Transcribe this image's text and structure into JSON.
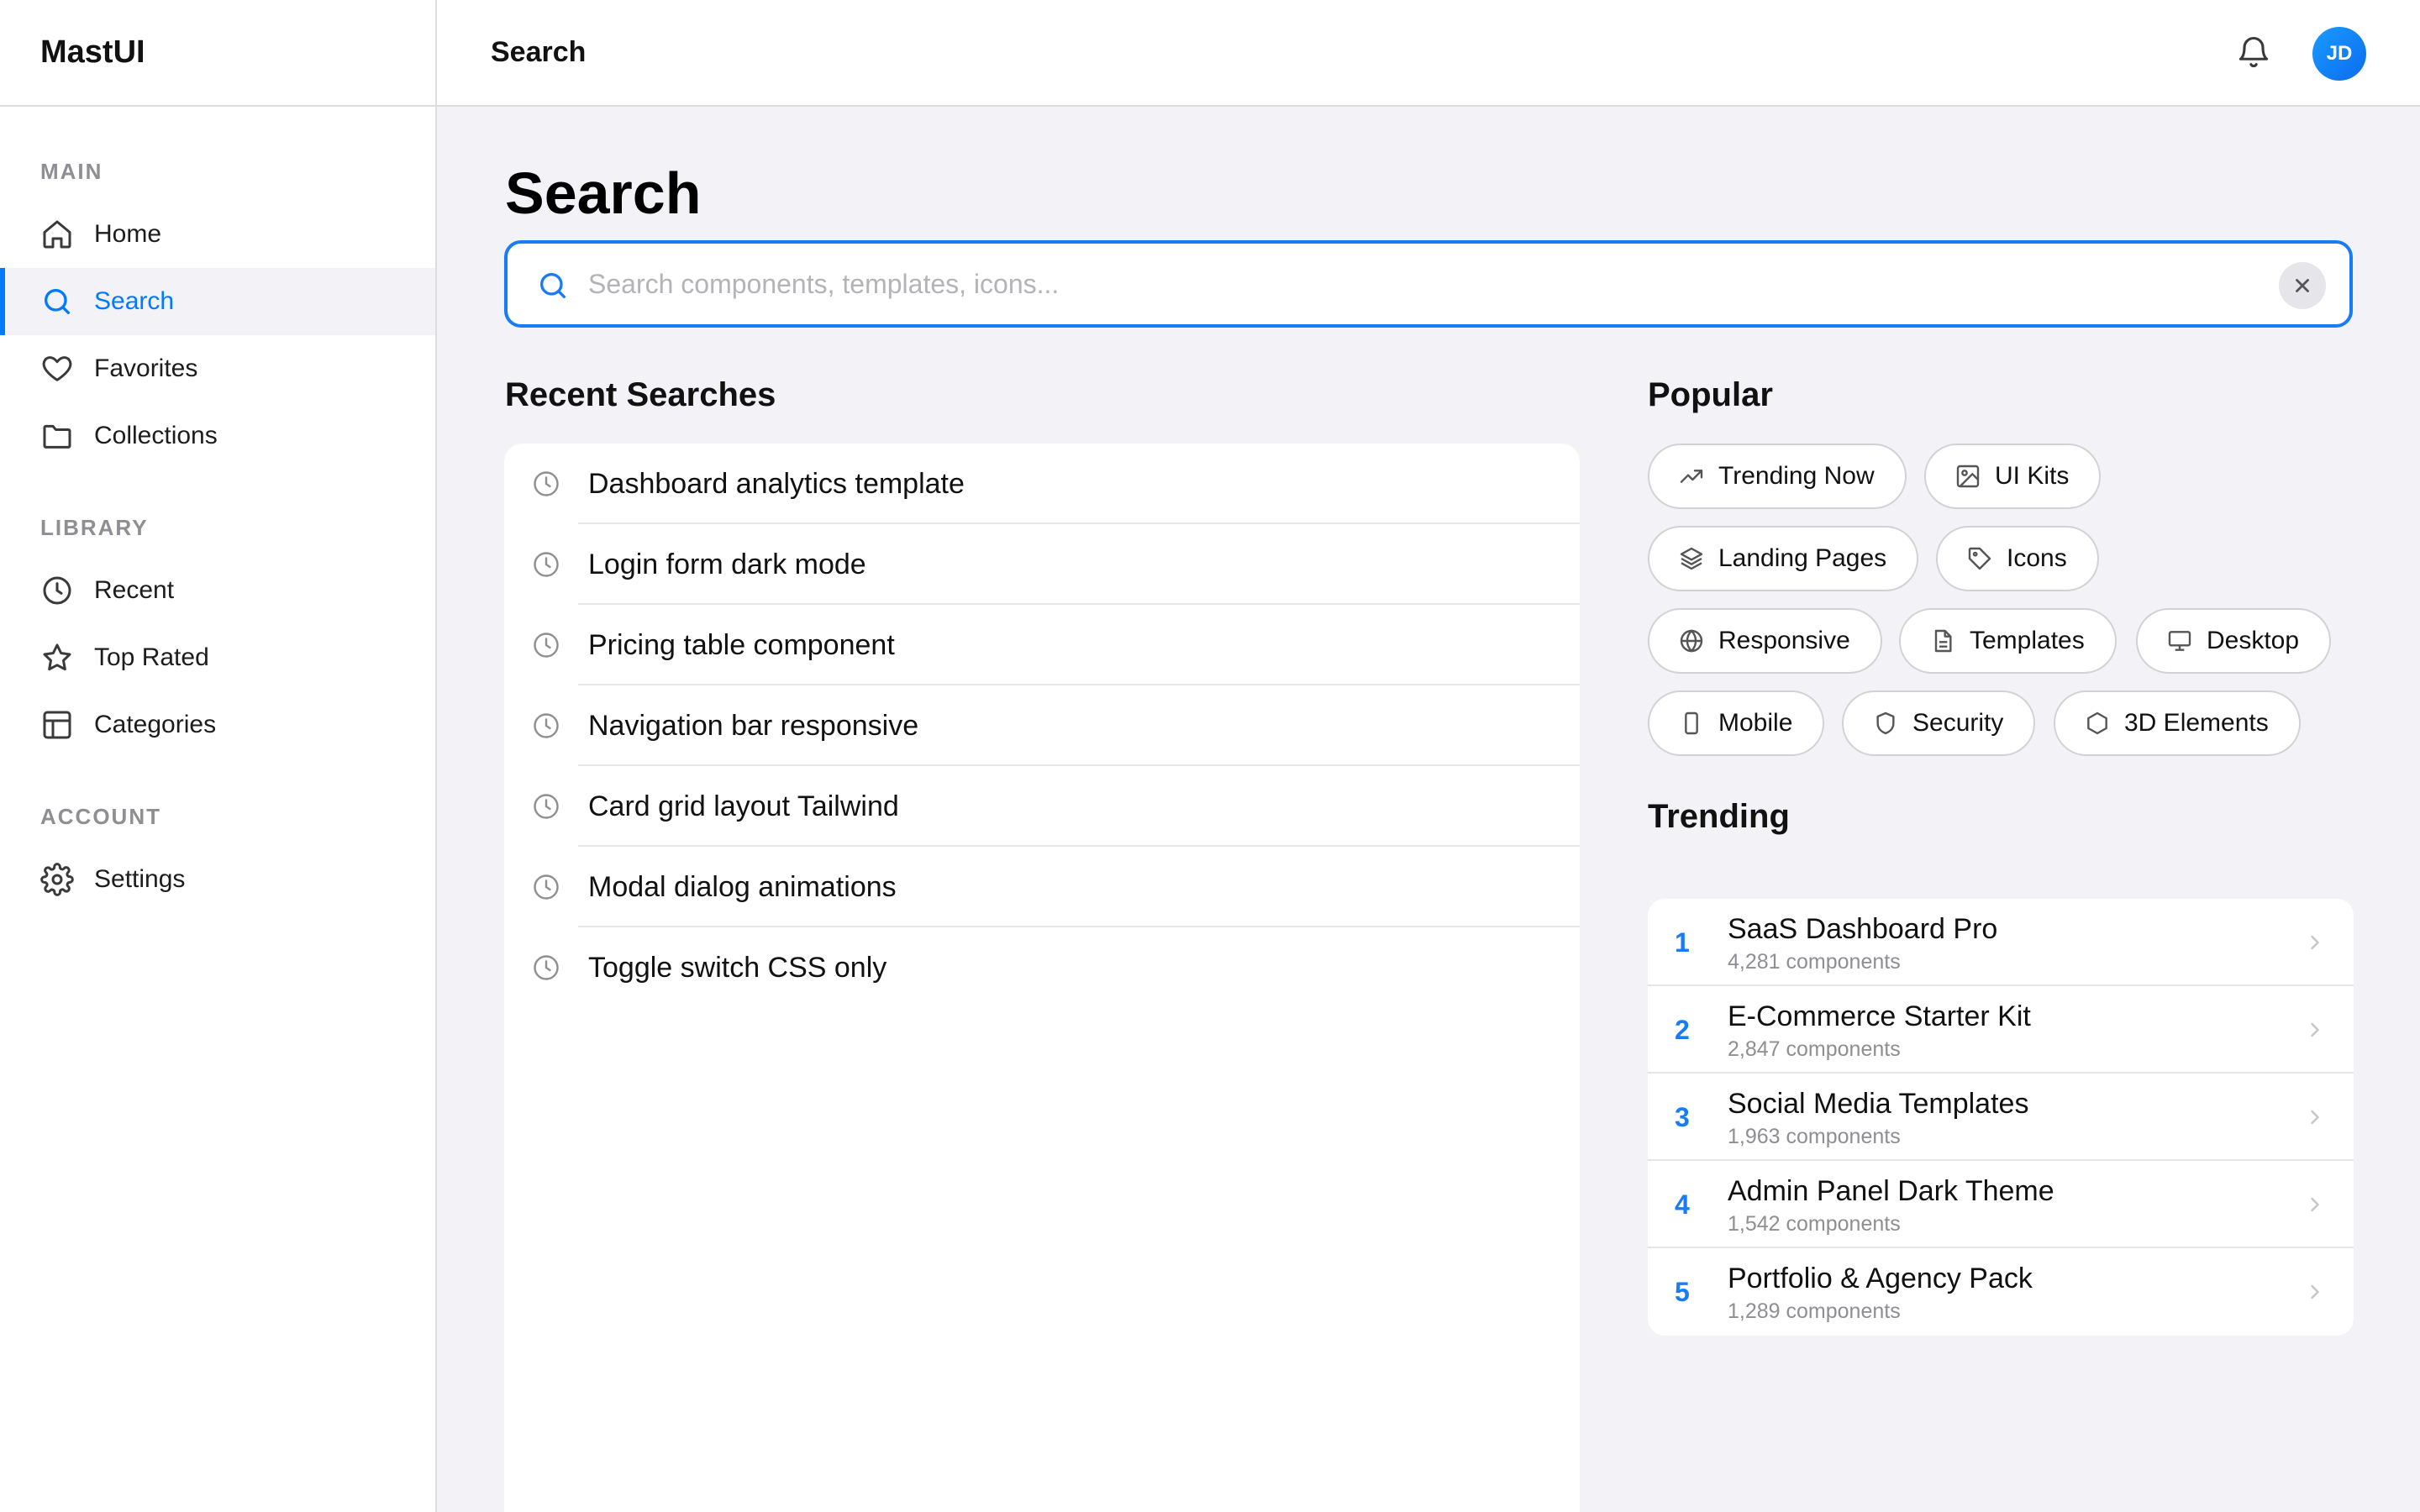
{
  "app": {
    "brand": "MastUI"
  },
  "sidebar": {
    "sections": [
      {
        "label": "MAIN",
        "items": [
          {
            "label": "Home",
            "icon": "home-icon"
          },
          {
            "label": "Search",
            "icon": "search-icon",
            "active": true
          },
          {
            "label": "Favorites",
            "icon": "heart-icon"
          },
          {
            "label": "Collections",
            "icon": "folder-icon"
          }
        ]
      },
      {
        "label": "LIBRARY",
        "items": [
          {
            "label": "Recent",
            "icon": "clock-icon"
          },
          {
            "label": "Top Rated",
            "icon": "star-icon"
          },
          {
            "label": "Categories",
            "icon": "layout-icon"
          }
        ]
      },
      {
        "label": "ACCOUNT",
        "items": [
          {
            "label": "Settings",
            "icon": "gear-icon"
          }
        ]
      }
    ]
  },
  "header": {
    "title": "Search",
    "avatar_initials": "JD"
  },
  "main": {
    "title": "Search",
    "search": {
      "placeholder": "Search components, templates, icons...",
      "value": ""
    },
    "recent": {
      "title": "Recent Searches",
      "items": [
        "Dashboard analytics template",
        "Login form dark mode",
        "Pricing table component",
        "Navigation bar responsive",
        "Card grid layout Tailwind",
        "Modal dialog animations",
        "Toggle switch CSS only"
      ]
    },
    "popular": {
      "title": "Popular",
      "chips": [
        {
          "label": "Trending Now",
          "icon": "trending-icon"
        },
        {
          "label": "UI Kits",
          "icon": "image-icon"
        },
        {
          "label": "Landing Pages",
          "icon": "layers-icon"
        },
        {
          "label": "Icons",
          "icon": "tag-icon"
        },
        {
          "label": "Responsive",
          "icon": "globe-icon"
        },
        {
          "label": "Templates",
          "icon": "file-icon"
        },
        {
          "label": "Desktop",
          "icon": "monitor-icon"
        },
        {
          "label": "Mobile",
          "icon": "smartphone-icon"
        },
        {
          "label": "Security",
          "icon": "shield-icon"
        },
        {
          "label": "3D Elements",
          "icon": "hexagon-icon"
        }
      ]
    },
    "trending": {
      "title": "Trending",
      "items": [
        {
          "rank": "1",
          "name": "SaaS Dashboard Pro",
          "count": "4,281 components"
        },
        {
          "rank": "2",
          "name": "E-Commerce Starter Kit",
          "count": "2,847 components"
        },
        {
          "rank": "3",
          "name": "Social Media Templates",
          "count": "1,963 components"
        },
        {
          "rank": "4",
          "name": "Admin Panel Dark Theme",
          "count": "1,542 components"
        },
        {
          "rank": "5",
          "name": "Portfolio & Agency Pack",
          "count": "1,289 components"
        }
      ]
    }
  },
  "colors": {
    "accent": "#007aff",
    "background": "#f2f2f7",
    "surface": "#ffffff",
    "muted": "#8e8e93"
  }
}
